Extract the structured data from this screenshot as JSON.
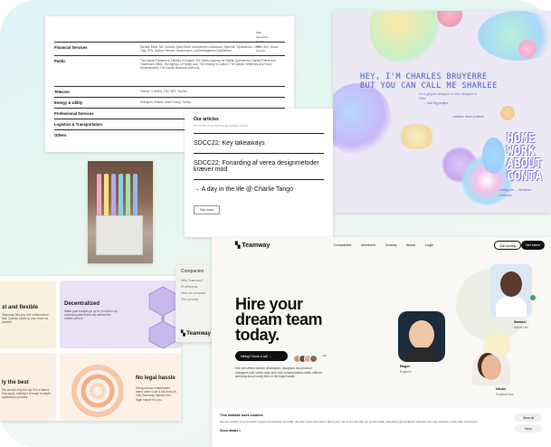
{
  "table_doc": {
    "rows": [
      {
        "label": "Financial Services",
        "value": "Danske Bank, NN, Nordea, Jyske Bank, Arbejdernes Landsbank, Nykredit, Topdanmark, Codan, Alm. Brand, Tryg, PFA, Danica Pension, Sampension, Lønmodtagernes Dyrtidsfond"
      },
      {
        "label": "Public",
        "value": "The Danish Parliament, Ministry of Justice, The Danish Agency for Digital Government, Danish Patent and Trademark Office, The Agency of Family Law, The Ministry of Culture, The Danish Veterinary and Food Administration, The Danish Business Authority"
      },
      {
        "label": "Telecom",
        "value": "Telenor, 3 (Hi3G), TDC NET, YouSee"
      },
      {
        "label": "Energy & Utility",
        "value": "Energinet, Ørsted, Andel Energi, Norlys"
      },
      {
        "label": "Professional Services",
        "value": ""
      },
      {
        "label": "Logistics & Transportation",
        "value": ""
      },
      {
        "label": "Others",
        "value": ""
      }
    ],
    "top_list": [
      "Web",
      "Interaction",
      "Mobile",
      "UX",
      "Service"
    ]
  },
  "portfolio": {
    "headline_1": "HEY, I'M CHARLES BRUYERRE",
    "headline_2": "BUT YOU CAN CALL ME SHARLEE",
    "subtitle": "I'm a graphic designer & ux/ui designer in Paris",
    "nav_left": "← last big project",
    "nav_mid": "↓ contact",
    "nav_right": "↓ more projects",
    "big_words": [
      "HOME",
      "WORK",
      "ABOUT",
      "CONTA"
    ],
    "links": [
      "→ Instagram",
      "→ Behance",
      "→ LinkedIn"
    ]
  },
  "articles": {
    "heading": "Our articles",
    "subheading": "We think of ourselves as design studio",
    "items": [
      "SDCC22: Key takeaways",
      "SDCC22: Fonarding af verea designmetoder kræver mod",
      "→ A day in the life @ Charlie Tango"
    ],
    "more_button": "See more"
  },
  "features": {
    "tiles": [
      {
        "title": "st and flexible",
        "desc": "Teamway lets you hire vetted talent fast. Quickly scale up your team as needed"
      },
      {
        "title": "Decentralized",
        "desc": "Make your budget go up to 4x further by accessing talent directly without the middle person"
      },
      {
        "title": "ly the best",
        "desc": "We accept only the top 3% of talent that apply, making it through in-depth application process"
      },
      {
        "title": "No legal hassle",
        "desc": "Hiring across independent talent used to be a full-time job, now Teamway handles the legal hassle for you"
      }
    ]
  },
  "companies_menu": {
    "heading": "Companies",
    "items": [
      "Why Teamway?",
      "Professions",
      "How we compare",
      "The process"
    ],
    "logo": "Teamway"
  },
  "teamway": {
    "logo": "Teamway",
    "nav": [
      "Companies",
      "Members",
      "Society",
      "About",
      "Login"
    ],
    "btn_join": "Join society",
    "btn_hire": "Hire talent",
    "hero": [
      "Hire your",
      "dream team",
      "today."
    ],
    "cta": "Hiring? Book a call →",
    "avatar_count": "+99",
    "desc": "Hire pre-vetted remote developers, designers and product managers with world-class tech and communication skills, without worrying about costly fees or the legal hassle.",
    "people": [
      {
        "name": "Samuel",
        "role": "Mobile Dev."
      },
      {
        "name": "Roger",
        "role": "Engineer"
      },
      {
        "name": "Nicole",
        "role": "Frontend Dev."
      }
    ],
    "cookie": {
      "title": "This website uses cookies",
      "text": "We use cookies to personalise content and analyse our traffic. We also share information about your use of our site with our social media, advertising and analytics partners who may combine it with other information.",
      "more": "Show details  >",
      "allow_all": "Allow all",
      "deny": "Deny"
    }
  },
  "colors": {
    "accent_purple": "#6a5ac8",
    "teamway_dark": "#111111",
    "background_tint": "#dff5f8"
  }
}
